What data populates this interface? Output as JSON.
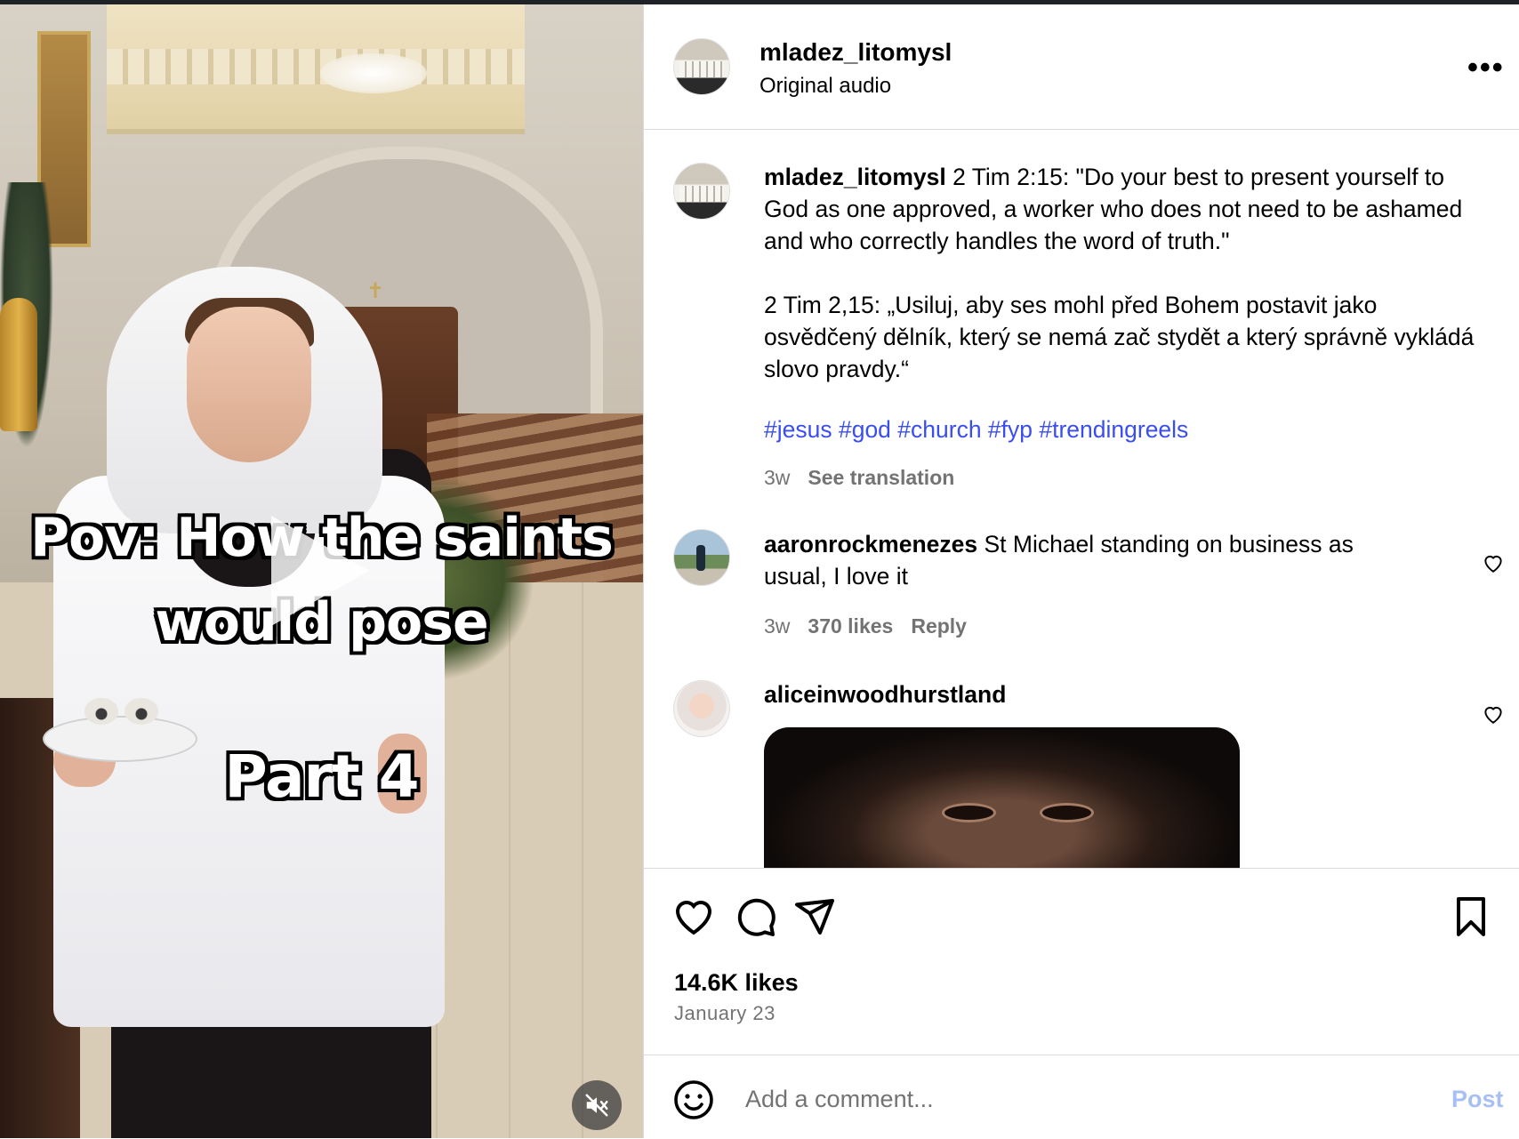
{
  "video": {
    "overlay_line1": "Pov: How the saints",
    "overlay_line2": "would pose",
    "overlay_line3": "Part 4"
  },
  "post": {
    "author": "mladez_litomysl",
    "audio": "Original audio",
    "caption_author": "mladez_litomysl",
    "caption_en": "2 Tim 2:15: \"Do your best to present yourself to God as one approved, a worker who does not need to be ashamed and who correctly handles the word of truth.\"",
    "caption_cz": "2 Tim 2,15: „Usiluj, aby ses mohl před Bohem postavit jako osvědčený dělník, který se nemá zač stydět a který správně vykládá slovo pravdy.“",
    "hashtags": "#jesus #god #church #fyp #trendingreels",
    "age": "3w",
    "see_translation": "See translation"
  },
  "comments": [
    {
      "user": "aaronrockmenezes",
      "text": "St Michael standing on business as usual, I love it",
      "age": "3w",
      "likes": "370 likes",
      "reply": "Reply"
    },
    {
      "user": "aliceinwoodhurstland",
      "text": ""
    }
  ],
  "footer": {
    "likes": "14.6K likes",
    "date": "January 23",
    "comment_placeholder": "Add a comment...",
    "post_label": "Post"
  },
  "colors": {
    "hashtag": "#3a4ef0",
    "muted": "#737373",
    "post_disabled": "#a8bff5"
  }
}
